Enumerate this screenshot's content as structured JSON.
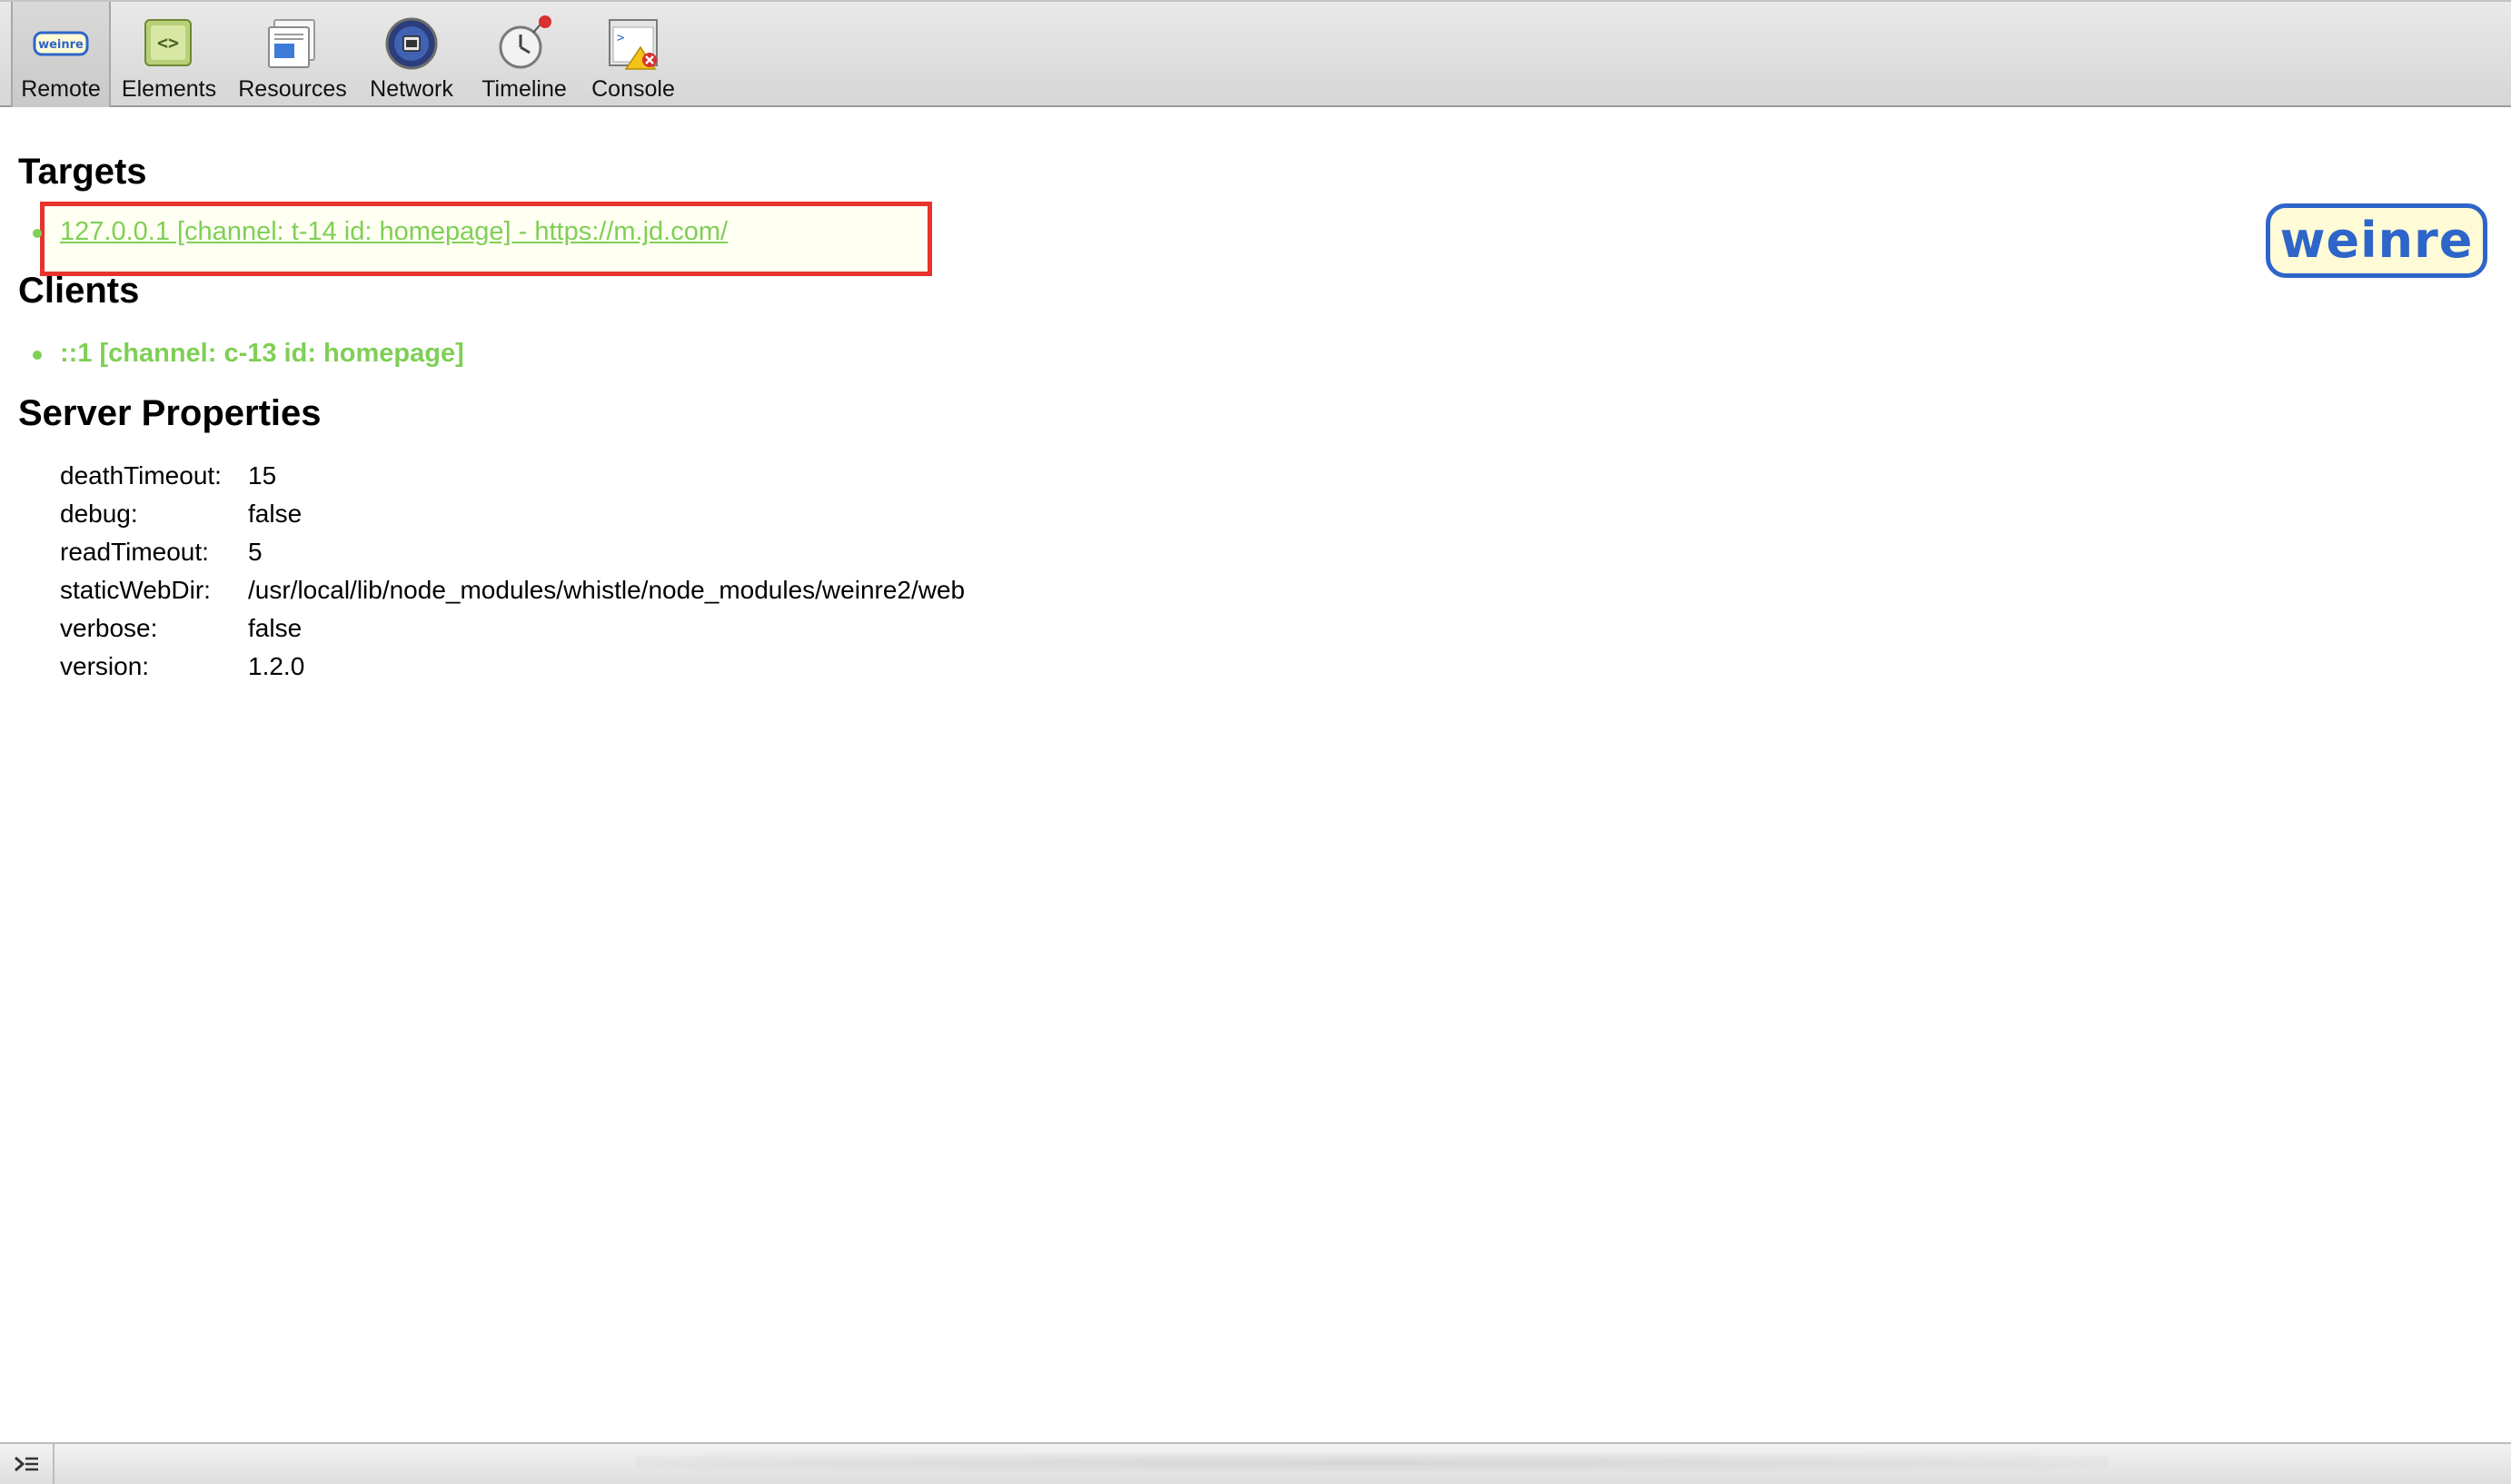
{
  "toolbar": {
    "tabs": [
      {
        "label": "Remote",
        "icon": "weinre-icon",
        "selected": true
      },
      {
        "label": "Elements",
        "icon": "elements-icon",
        "selected": false
      },
      {
        "label": "Resources",
        "icon": "resources-icon",
        "selected": false
      },
      {
        "label": "Network",
        "icon": "network-icon",
        "selected": false
      },
      {
        "label": "Timeline",
        "icon": "timeline-icon",
        "selected": false
      },
      {
        "label": "Console",
        "icon": "console-icon",
        "selected": false
      }
    ],
    "remote_icon_text": "weinre"
  },
  "logo": {
    "text": "weinre"
  },
  "targets": {
    "heading": "Targets",
    "items": [
      "127.0.0.1 [channel: t-14 id: homepage] - https://m.jd.com/"
    ]
  },
  "clients": {
    "heading": "Clients",
    "items": [
      "::1 [channel: c-13 id: homepage]"
    ]
  },
  "server_properties": {
    "heading": "Server Properties",
    "rows": [
      {
        "key": "deathTimeout:",
        "value": "15"
      },
      {
        "key": "debug:",
        "value": "false"
      },
      {
        "key": "readTimeout:",
        "value": "5"
      },
      {
        "key": "staticWebDir:",
        "value": "/usr/local/lib/node_modules/whistle/node_modules/weinre2/web"
      },
      {
        "key": "verbose:",
        "value": "false"
      },
      {
        "key": "version:",
        "value": "1.2.0"
      }
    ]
  },
  "colors": {
    "link_green": "#7fcf56",
    "highlight_red": "#e8322b",
    "logo_blue": "#2e65c9"
  },
  "statusbar": {
    "console_toggle_icon": "console-toggle-icon"
  }
}
